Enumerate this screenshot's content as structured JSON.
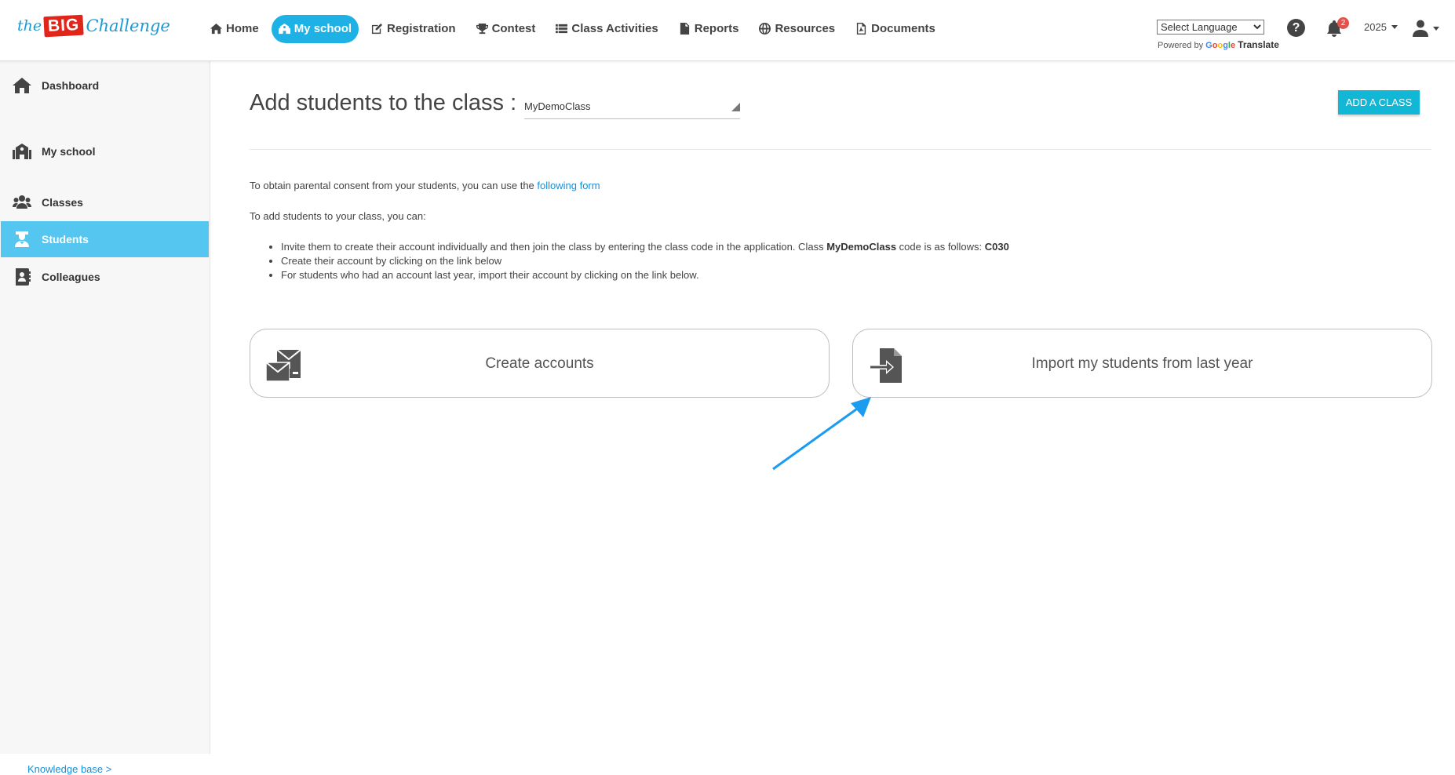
{
  "brand": {
    "the": "the",
    "big": "BIG",
    "challenge": "Challenge"
  },
  "nav": [
    {
      "label": "Home",
      "icon": "home-icon"
    },
    {
      "label": "My school",
      "icon": "school-icon",
      "active": true
    },
    {
      "label": "Registration",
      "icon": "edit-icon"
    },
    {
      "label": "Contest",
      "icon": "trophy-icon"
    },
    {
      "label": "Class Activities",
      "icon": "list-icon"
    },
    {
      "label": "Reports",
      "icon": "file-text-icon"
    },
    {
      "label": "Resources",
      "icon": "globe-icon"
    },
    {
      "label": "Documents",
      "icon": "pdf-icon"
    }
  ],
  "translate": {
    "select_label": "Select Language",
    "powered_by": "Powered by",
    "google": "Google",
    "translate": "Translate"
  },
  "header": {
    "help": "?",
    "notifications_count": "2",
    "year": "2025"
  },
  "sidebar": {
    "items": [
      {
        "label": "Dashboard",
        "icon": "home-icon"
      },
      {
        "label": "My school",
        "icon": "school-icon"
      },
      {
        "label": "Classes",
        "icon": "users-icon"
      },
      {
        "label": "Students",
        "icon": "student-icon",
        "active": true
      },
      {
        "label": "Colleagues",
        "icon": "contact-book-icon"
      }
    ],
    "knowledge_base": "Knowledge base >"
  },
  "main": {
    "title": "Add students to the class :",
    "class_selected": "MyDemoClass",
    "add_class_button": "Add a class",
    "consent_text": "To obtain parental consent from your students, you can use the ",
    "consent_link": "following form",
    "intro": "To add students to your class, you can:",
    "bullet1_pre": "Invite them to create their account individually and then join the class by entering the class code in the application. Class ",
    "bullet1_class": "MyDemoClass",
    "bullet1_mid": " code is as follows: ",
    "bullet1_code": "C030",
    "bullet2": "Create their account by clicking on the link below",
    "bullet3": "For students who had an account last year, import their account by clicking on the link below.",
    "card_create": "Create accounts",
    "card_import": "Import my students from last year"
  },
  "colors": {
    "accent": "#1eb1e6",
    "sidebar_active": "#55c6f0",
    "button": "#13b7d6",
    "annotation_arrow": "#1a9cf0"
  }
}
